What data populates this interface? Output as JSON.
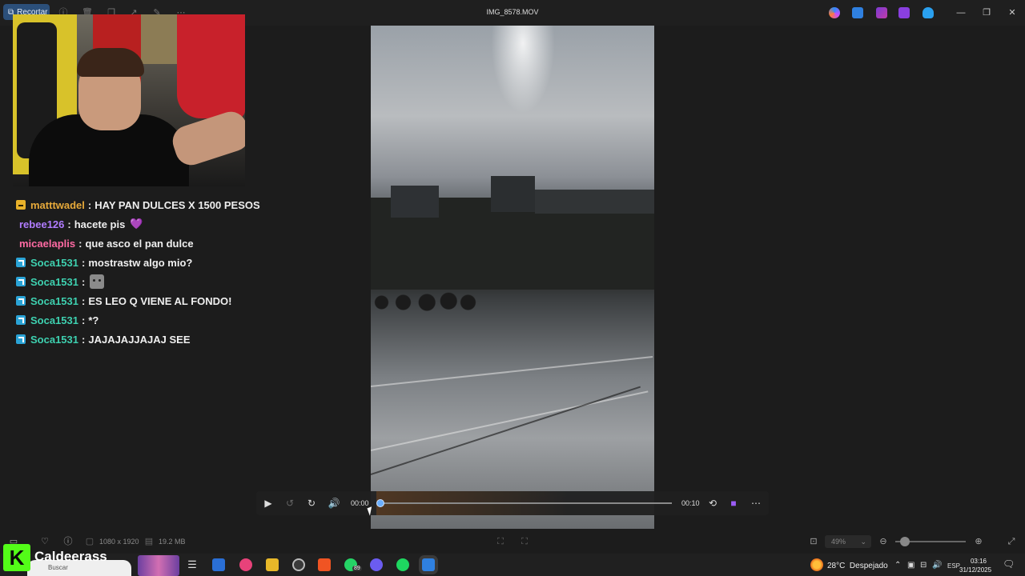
{
  "window": {
    "title": "IMG_8578.MOV",
    "crop_label": "Recortar",
    "toolbar_icons": [
      "info-icon",
      "delete-icon",
      "copy-icon",
      "share-icon",
      "edit-icon",
      "more-icon"
    ],
    "app_icons": [
      "copilot-icon",
      "photos-icon",
      "clipchamp-icon",
      "video-editor-icon",
      "onedrive-icon"
    ],
    "controls": [
      "minimize",
      "maximize",
      "close"
    ]
  },
  "chat": {
    "messages": [
      {
        "user": "matttwadel",
        "text": "HAY PAN DULCES X 1500 PESOS",
        "badge": "sub",
        "color": "#e6a93a"
      },
      {
        "user": "rebee126",
        "text": "hacete pis",
        "badge": "",
        "color": "#b17cff",
        "emoji": "💜"
      },
      {
        "user": "micaelaplis",
        "text": "que asco el pan dulce",
        "badge": "",
        "color": "#ff6aa3"
      },
      {
        "user": "Soca1531",
        "text": "mostrastw algo mio?",
        "badge": "prime",
        "color": "#3ed1b0"
      },
      {
        "user": "Soca1531",
        "text": "",
        "badge": "prime",
        "color": "#3ed1b0",
        "emote": "cat-emote"
      },
      {
        "user": "Soca1531",
        "text": "ES LEO Q VIENE AL FONDO!",
        "badge": "prime",
        "color": "#3ed1b0"
      },
      {
        "user": "Soca1531",
        "text": "*?",
        "badge": "prime",
        "color": "#3ed1b0"
      },
      {
        "user": "Soca1531",
        "text": "JAJAJAJJAJAJ SEE",
        "badge": "prime",
        "color": "#3ed1b0"
      }
    ]
  },
  "player": {
    "current_time": "00:00",
    "duration": "00:10",
    "progress": 0
  },
  "info": {
    "dimensions": "1080 x 1920",
    "size": "19.2 MB",
    "zoom": "49%"
  },
  "stream": {
    "platform_glyph": "K",
    "streamer": "Caldeerass",
    "accent": "#53fc18"
  },
  "taskbar": {
    "search_label": "Buscar",
    "whatsapp_badge": "89",
    "weather_temp": "28°C",
    "weather_desc": "Despejado",
    "lang": "ESP",
    "time": "03:16",
    "date": "31/12/2025"
  }
}
